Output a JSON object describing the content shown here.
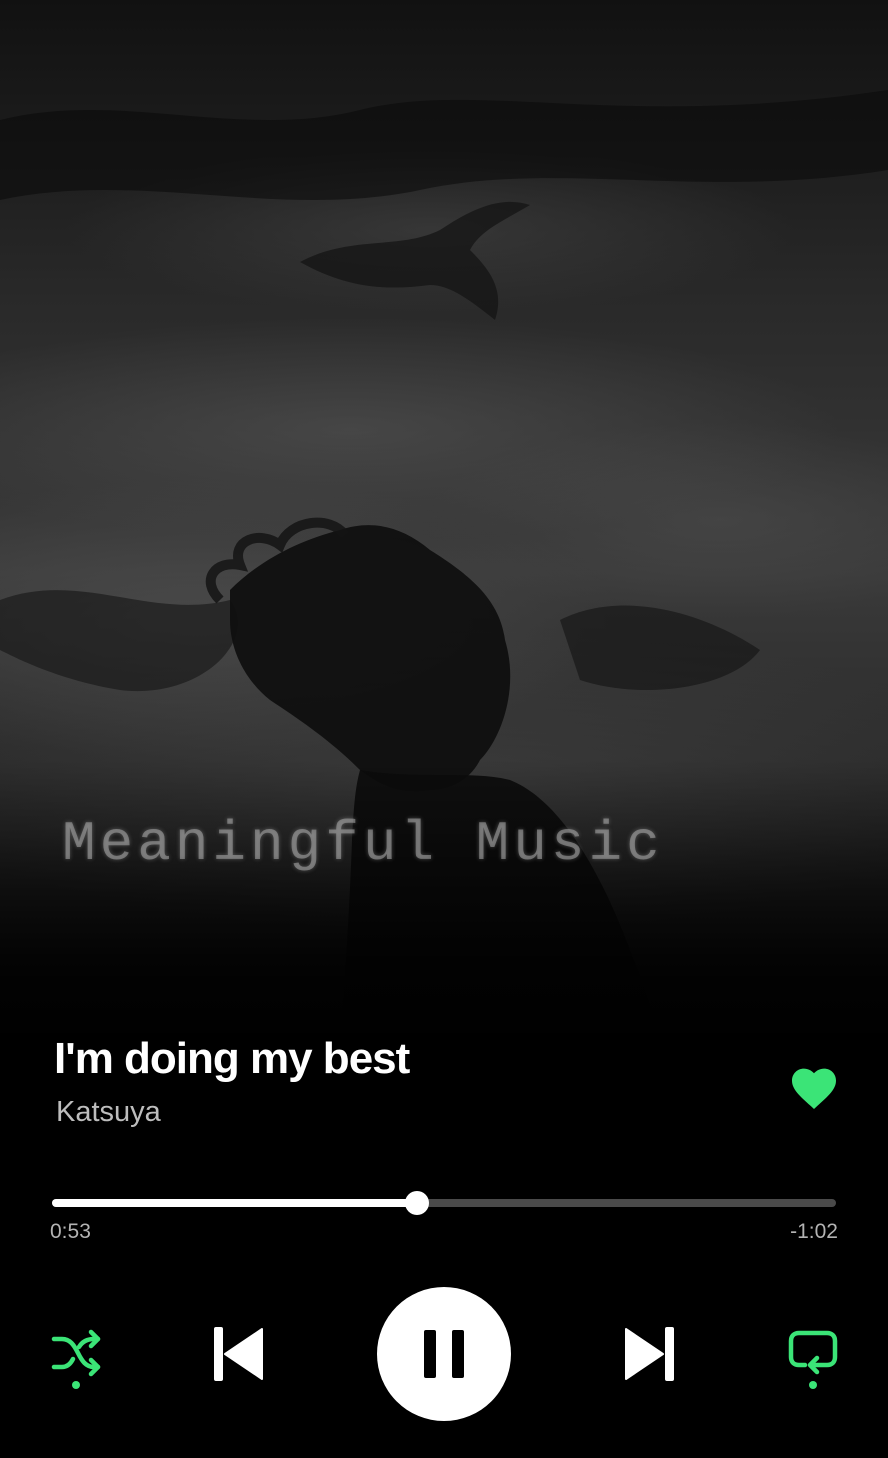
{
  "artwork": {
    "watermark_text": "Meaningful Music"
  },
  "track": {
    "title": "I'm doing my best",
    "artist": "Katsuya",
    "liked": true
  },
  "playback": {
    "elapsed": "0:53",
    "remaining": "-1:02",
    "progress_fraction": 0.466,
    "state": "playing",
    "shuffle_enabled": true,
    "repeat_enabled": true
  },
  "icons": {
    "like": "heart-icon",
    "shuffle": "shuffle-icon",
    "previous": "skip-previous-icon",
    "play_pause": "pause-icon",
    "next": "skip-next-icon",
    "repeat": "repeat-icon"
  },
  "colors": {
    "accent": "#3be477",
    "background": "#000000",
    "text_primary": "#ffffff",
    "text_secondary": "#b3b3b3",
    "progress_track": "#4a4a4a"
  }
}
